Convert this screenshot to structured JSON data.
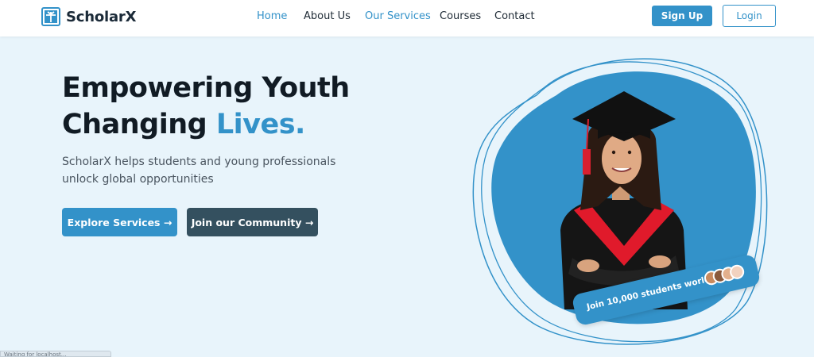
{
  "brand": {
    "name": "ScholarX",
    "accent_color": "#3392c9",
    "dark_color": "#34505f"
  },
  "nav": {
    "links": [
      {
        "label": "Home",
        "active": true
      },
      {
        "label": "About Us",
        "active": false
      },
      {
        "label": "Our Services",
        "active": true
      },
      {
        "label": "Courses",
        "active": false
      },
      {
        "label": "Contact",
        "active": false
      }
    ],
    "signup_label": "Sign Up",
    "login_label": "Login"
  },
  "hero": {
    "title_line1": "Empowering Youth",
    "title_line2_plain": "Changing ",
    "title_line2_accent": "Lives.",
    "subtitle": "ScholarX helps students and young professionals unlock global opportunities",
    "explore_label": "Explore Services →",
    "community_label": "Join our Community →"
  },
  "badge": {
    "text": "Join 10,000 students worldwide",
    "avatar_colors": [
      "#c98a5e",
      "#8a5a3c",
      "#e3b08c",
      "#f2d2bf"
    ]
  },
  "status_bar": {
    "text": "Waiting for localhost..."
  }
}
